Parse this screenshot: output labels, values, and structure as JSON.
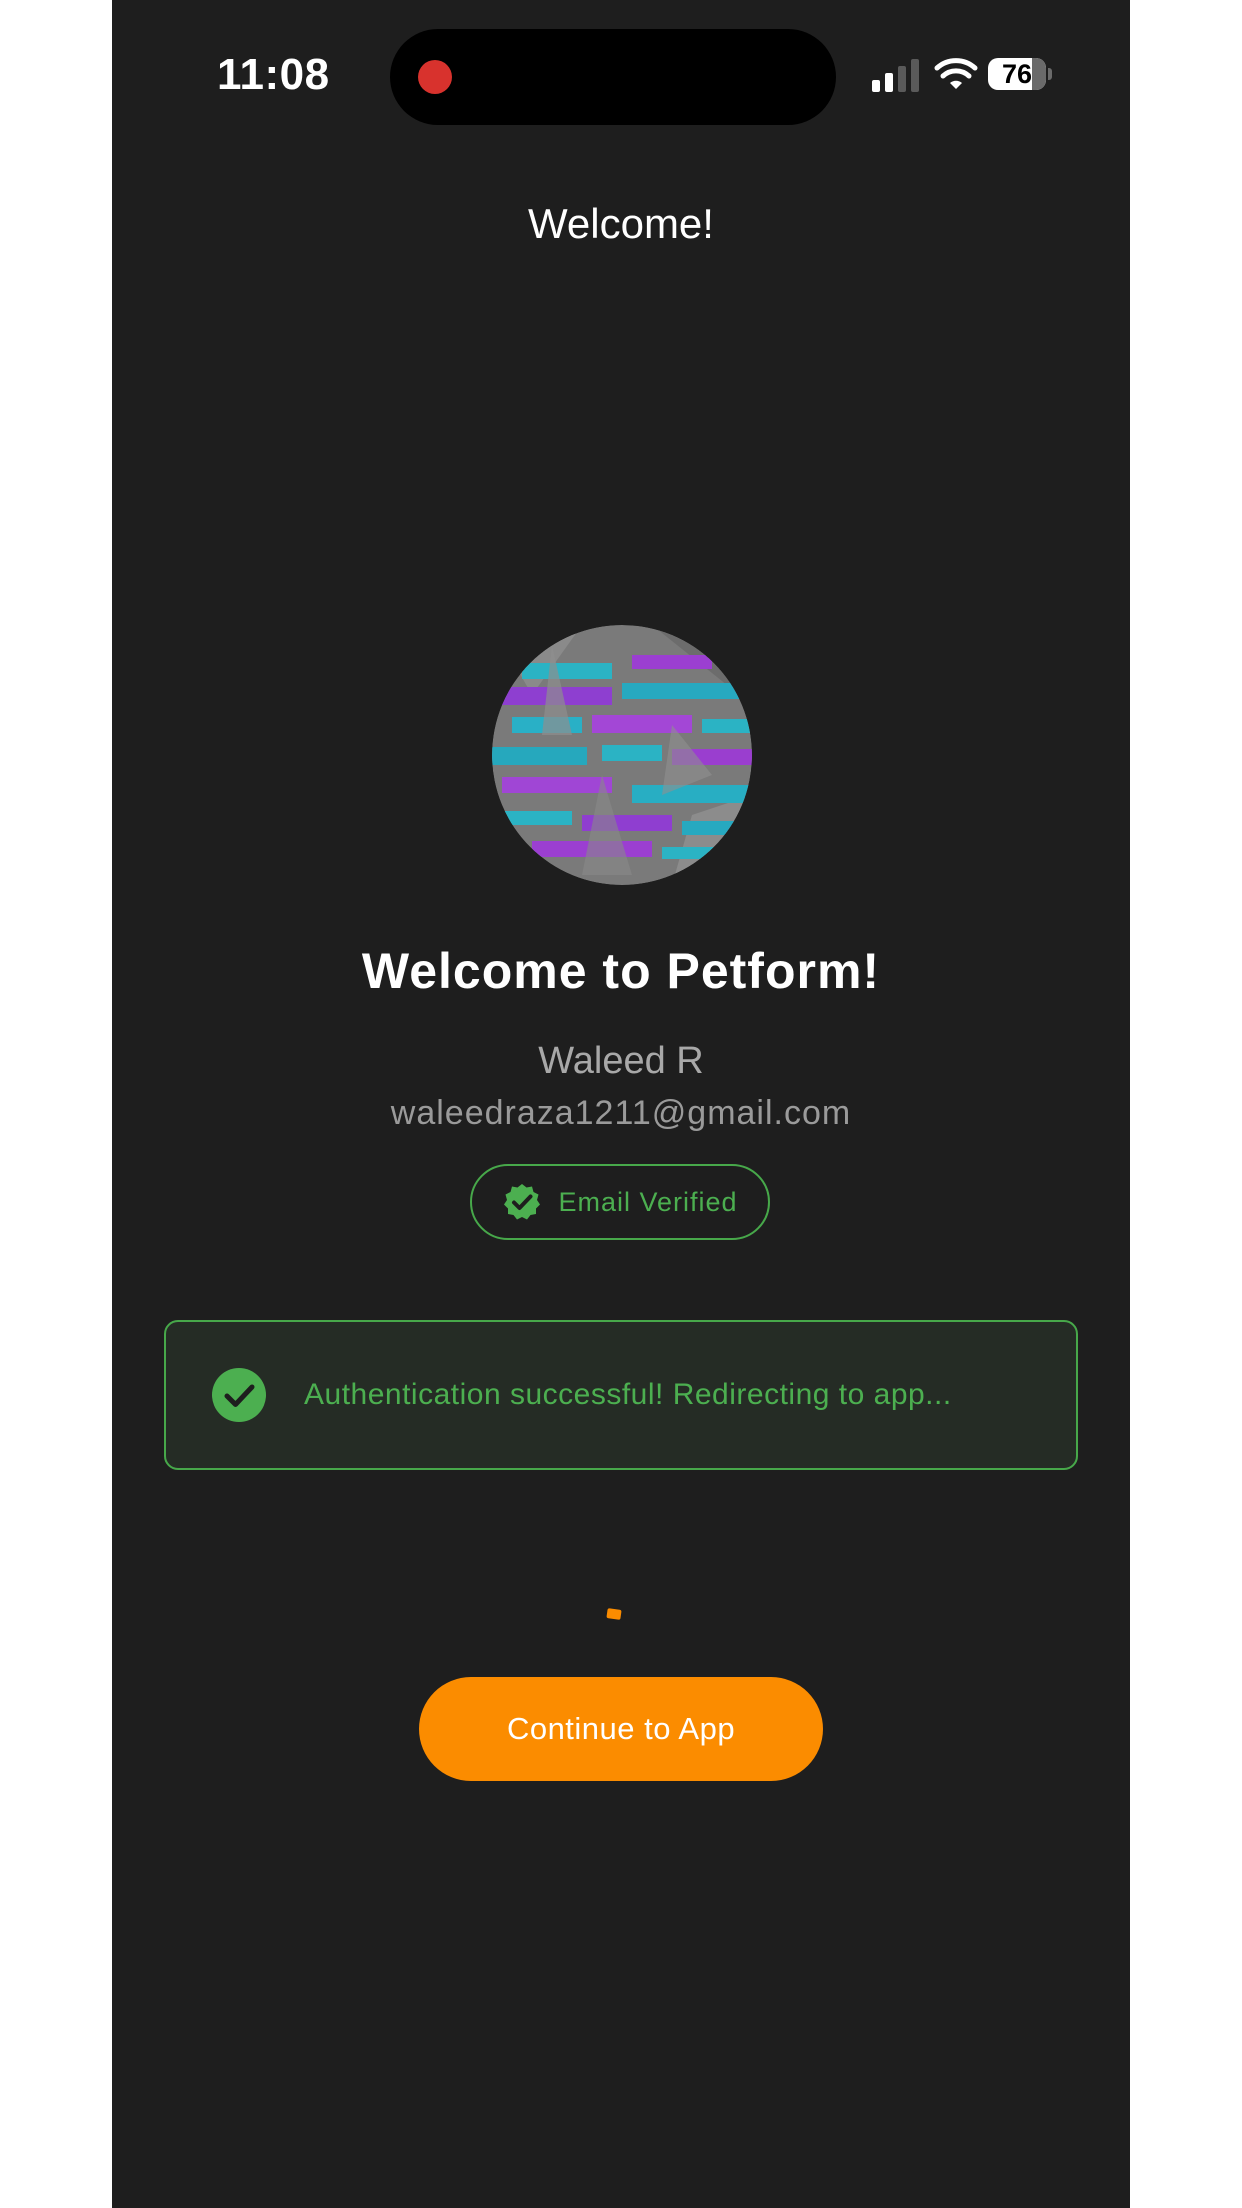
{
  "status_bar": {
    "time": "11:08",
    "battery_percent": "76",
    "battery_level": 0.76,
    "signal_bars_active": 2,
    "signal_bars_total": 4,
    "recording_indicator_color": "#d8322d"
  },
  "header": {
    "title": "Welcome!"
  },
  "profile": {
    "welcome_title": "Welcome to Petform!",
    "name": "Waleed R",
    "email": "waleedraza1211@gmail.com",
    "verified_badge_label": "Email Verified",
    "verified_icon": "verified-check-icon"
  },
  "auth_status": {
    "message": "Authentication successful! Redirecting to app...",
    "icon": "check-circle-icon"
  },
  "actions": {
    "continue_label": "Continue to App"
  },
  "theme": {
    "background": "#1e1e1e",
    "accent_orange": "#fb8c00",
    "success_green": "#4caf50"
  }
}
